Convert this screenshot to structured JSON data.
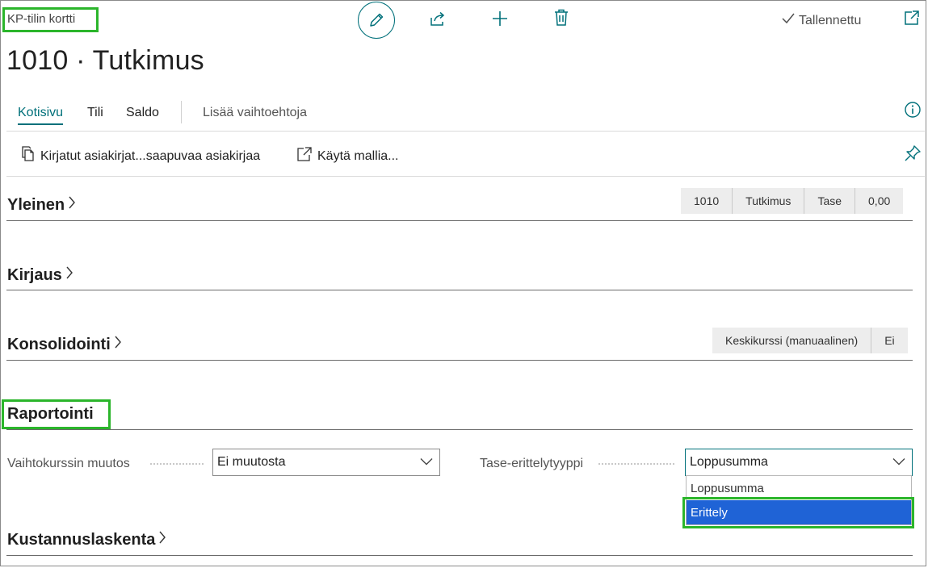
{
  "header": {
    "page_type": "KP-tilin kortti",
    "title": "1010 · Tutkimus",
    "saved_status": "Tallennettu"
  },
  "toolbar": {
    "icons": [
      "edit-icon",
      "share-icon",
      "new-icon",
      "delete-icon",
      "open-new-window-icon"
    ]
  },
  "tabs": [
    {
      "label": "Kotisivu",
      "active": true
    },
    {
      "label": "Tili",
      "active": false
    },
    {
      "label": "Saldo",
      "active": false
    },
    {
      "label": "Lisää vaihtoehtoja",
      "active": false
    }
  ],
  "actions": [
    {
      "label": "Kirjatut asiakirjat...saapuvaa asiakirjaa",
      "icon": "document-icon"
    },
    {
      "label": "Käytä mallia...",
      "icon": "template-icon"
    }
  ],
  "sections": {
    "yleinen": {
      "title": "Yleinen",
      "summary": [
        "1010",
        "Tutkimus",
        "Tase",
        "0,00"
      ]
    },
    "kirjaus": {
      "title": "Kirjaus"
    },
    "konsolidointi": {
      "title": "Konsolidointi",
      "summary": [
        "Keskikurssi (manuaalinen)",
        "Ei"
      ]
    },
    "raportointi": {
      "title": "Raportointi",
      "fields": {
        "exchange_change": {
          "label": "Vaihtokurssin muutos",
          "value": "Ei muutosta"
        },
        "balance_type": {
          "label": "Tase-erittelytyyppi",
          "value": "Loppusumma",
          "options": [
            "Loppusumma",
            "Erittely"
          ],
          "highlighted_option": "Erittely"
        }
      }
    },
    "kustannuslaskenta": {
      "title": "Kustannuslaskenta"
    }
  },
  "colors": {
    "accent": "#00707a",
    "highlight_box": "#2bb52b",
    "selected_option": "#1f63d6"
  }
}
